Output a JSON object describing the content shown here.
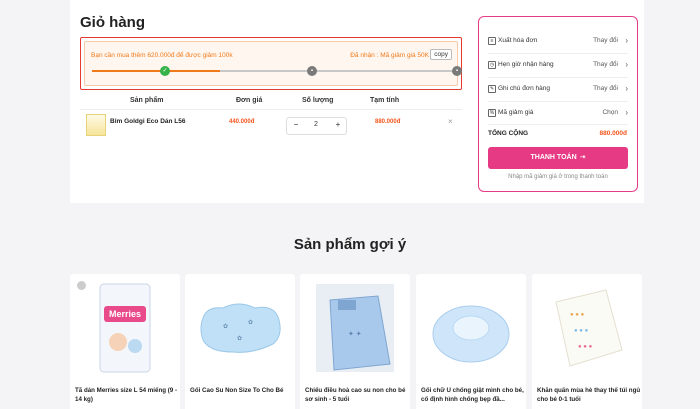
{
  "cart": {
    "title": "Giỏ hàng",
    "promo": {
      "message": "Bạn cần mua thêm 620.000đ để được giảm 100k",
      "received": "Đã nhận : Mã giảm giá 50K",
      "copy_label": "copy",
      "progress": 0.35,
      "milestones": [
        {
          "state": "done",
          "icon": "check-icon"
        },
        {
          "state": "locked",
          "icon": "gift-icon"
        },
        {
          "state": "locked",
          "icon": "gift-icon"
        }
      ]
    },
    "columns": [
      "Sản phẩm",
      "Đơn giá",
      "Số lượng",
      "Tạm tính"
    ],
    "items": [
      {
        "name": "Bỉm Goldgi Eco Dán L56",
        "price": "440.000đ",
        "quantity": "2",
        "line_total": "880.000đ"
      }
    ]
  },
  "summary": {
    "rows": [
      {
        "label": "Xuất hóa đơn",
        "action": "Thay đổi",
        "icon": "receipt-icon"
      },
      {
        "label": "Hẹn giờ nhận hàng",
        "action": "Thay đổi",
        "icon": "clock-icon"
      },
      {
        "label": "Ghi chú đơn hàng",
        "action": "Thay đổi",
        "icon": "note-icon"
      },
      {
        "label": "Mã giảm giá",
        "action": "Chọn",
        "icon": "coupon-icon"
      }
    ],
    "total_label": "TỔNG CỘNG",
    "total_value": "880.000đ",
    "checkout_label": "THANH TOÁN",
    "note": "Nhập mã giảm giá ở trong thanh toán"
  },
  "recommendations": {
    "title": "Sản phẩm gợi ý",
    "items": [
      {
        "name": "Tã dán Merries size L 54 miếng (9 - 14 kg)",
        "brand_label": "Merries"
      },
      {
        "name": "Gối Cao Su Non Size To Cho Bé"
      },
      {
        "name": "Chiếu điều hoà cao su non cho bé sơ sinh - 5 tuổi"
      },
      {
        "name": "Gối chữ U chống giật mình cho bé, cố định hình chống bẹp đầ..."
      },
      {
        "name": "Khăn quấn mùa hè thay thế túi ngủ cho bé 0-1 tuổi"
      }
    ]
  },
  "colors": {
    "accent_pink": "#e63a84",
    "price_orange": "#f3541c",
    "promo_orange": "#f07a1a",
    "highlight_red": "#e8392f"
  }
}
